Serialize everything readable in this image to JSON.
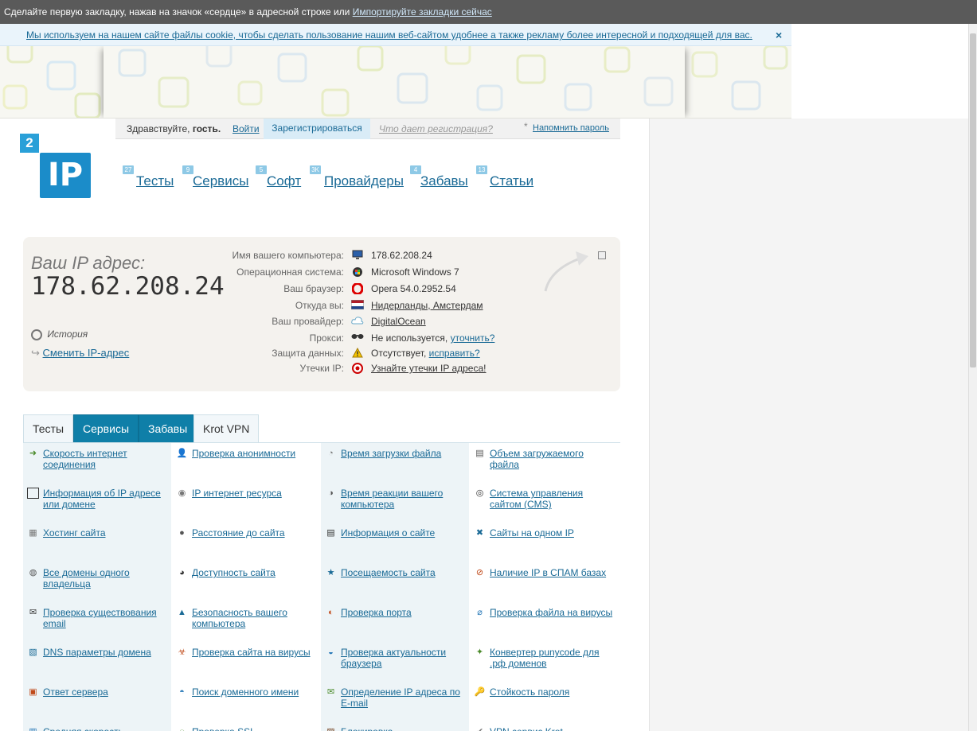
{
  "browser": {
    "bookmark_prompt": "Сделайте первую закладку, нажав на значок «сердце» в адресной строке или",
    "import_link": "Импортируйте закладки сейчас"
  },
  "cookie": {
    "text": "Мы используем на нашем сайте файлы cookie, чтобы сделать пользование нашим веб-сайтом удобнее а также рекламу более интересной и подходящей для вас.",
    "close": "×"
  },
  "login": {
    "greeting": "Здравствуйте,",
    "guest": "гость.",
    "login_link": "Войти",
    "register": "Зарегистрироваться",
    "what_reg": "Что дает регистрация?",
    "star": "*",
    "remind": "Напомнить пароль"
  },
  "logo": {
    "badge": "2",
    "text": "IP"
  },
  "nav": [
    {
      "label": "Тесты",
      "badge": "27"
    },
    {
      "label": "Сервисы",
      "badge": "9"
    },
    {
      "label": "Софт",
      "badge": "5"
    },
    {
      "label": "Провайдеры",
      "badge": "3K"
    },
    {
      "label": "Забавы",
      "badge": "4"
    },
    {
      "label": "Статьи",
      "badge": "13"
    }
  ],
  "ip_panel": {
    "label": "Ваш IP адрес:",
    "ip": "178.62.208.24",
    "history": "История",
    "change_ip": "Сменить IP-адрес",
    "rows": [
      {
        "label": "Имя вашего компьютера:",
        "icon": "monitor-icon",
        "value": "178.62.208.24"
      },
      {
        "label": "Операционная система:",
        "icon": "windows-icon",
        "value": "Microsoft Windows 7"
      },
      {
        "label": "Ваш браузер:",
        "icon": "opera-icon",
        "value": "Opera 54.0.2952.54"
      },
      {
        "label": "Откуда вы:",
        "icon": "flag-icon",
        "value": "Нидерланды, Амстердам"
      },
      {
        "label": "Ваш провайдер:",
        "icon": "cloud-icon",
        "value": "DigitalOcean"
      },
      {
        "label": "Прокси:",
        "icon": "glasses-icon",
        "value": "Не используется,",
        "link": "уточнить?"
      },
      {
        "label": "Защита данных:",
        "icon": "warning-icon",
        "value": "Отсутствует,",
        "link": "исправить?"
      },
      {
        "label": "Утечки IP:",
        "icon": "leak-icon",
        "value": "Узнайте утечки IP адреса!"
      }
    ]
  },
  "tabs": [
    {
      "label": "Тесты"
    },
    {
      "label": "Сервисы"
    },
    {
      "label": "Забавы"
    },
    {
      "label": "Krot VPN"
    }
  ],
  "services": [
    [
      "Скорость интернет соединения",
      "Проверка анонимности",
      "Время загрузки файла",
      "Объем загружаемого файла"
    ],
    [
      "Информация об IP адресе или домене",
      "IP интернет ресурса",
      "Время реакции вашего компьютера",
      "Система управления сайтом (CMS)"
    ],
    [
      "Хостинг сайта",
      "Расстояние до сайта",
      "Информация о сайте",
      "Сайты на одном IP"
    ],
    [
      "Все домены одного владельца",
      "Доступность сайта",
      "Посещаемость сайта",
      "Наличие IP в СПАМ базах"
    ],
    [
      "Проверка существования email",
      "Безопасность вашего компьютера",
      "Проверка порта",
      "Проверка файла на вирусы"
    ],
    [
      "DNS параметры домена",
      "Проверка сайта на вирусы",
      "Проверка актуальности браузера",
      "Конвертер punycode для .рф доменов"
    ],
    [
      "Ответ сервера",
      "Поиск доменного имени",
      "Определение IP адреса по E-mail",
      "Стойкость пароля"
    ],
    [
      "Средняя скорость",
      "Проверка SSL",
      "Блокировка",
      "VPN сервис Krot"
    ]
  ],
  "service_icons": [
    [
      "speed-icon",
      "anon-icon",
      "clock-icon",
      "file-size-icon"
    ],
    [
      "ip-info-icon",
      "ip-resource-icon",
      "reaction-icon",
      "cms-icon"
    ],
    [
      "hosting-icon",
      "pin-icon",
      "document-icon",
      "network-icon"
    ],
    [
      "domains-icon",
      "availability-icon",
      "star-icon",
      "spam-icon"
    ],
    [
      "email-icon",
      "lock-icon",
      "globe-icon",
      "virus-file-icon"
    ],
    [
      "dns-icon",
      "site-virus-icon",
      "browser-icon",
      "punycode-icon"
    ],
    [
      "server-icon",
      "domain-search-icon",
      "email-ip-icon",
      "password-icon"
    ],
    [
      "avg-speed-icon",
      "ssl-icon",
      "block-icon",
      "vpn-icon"
    ]
  ]
}
